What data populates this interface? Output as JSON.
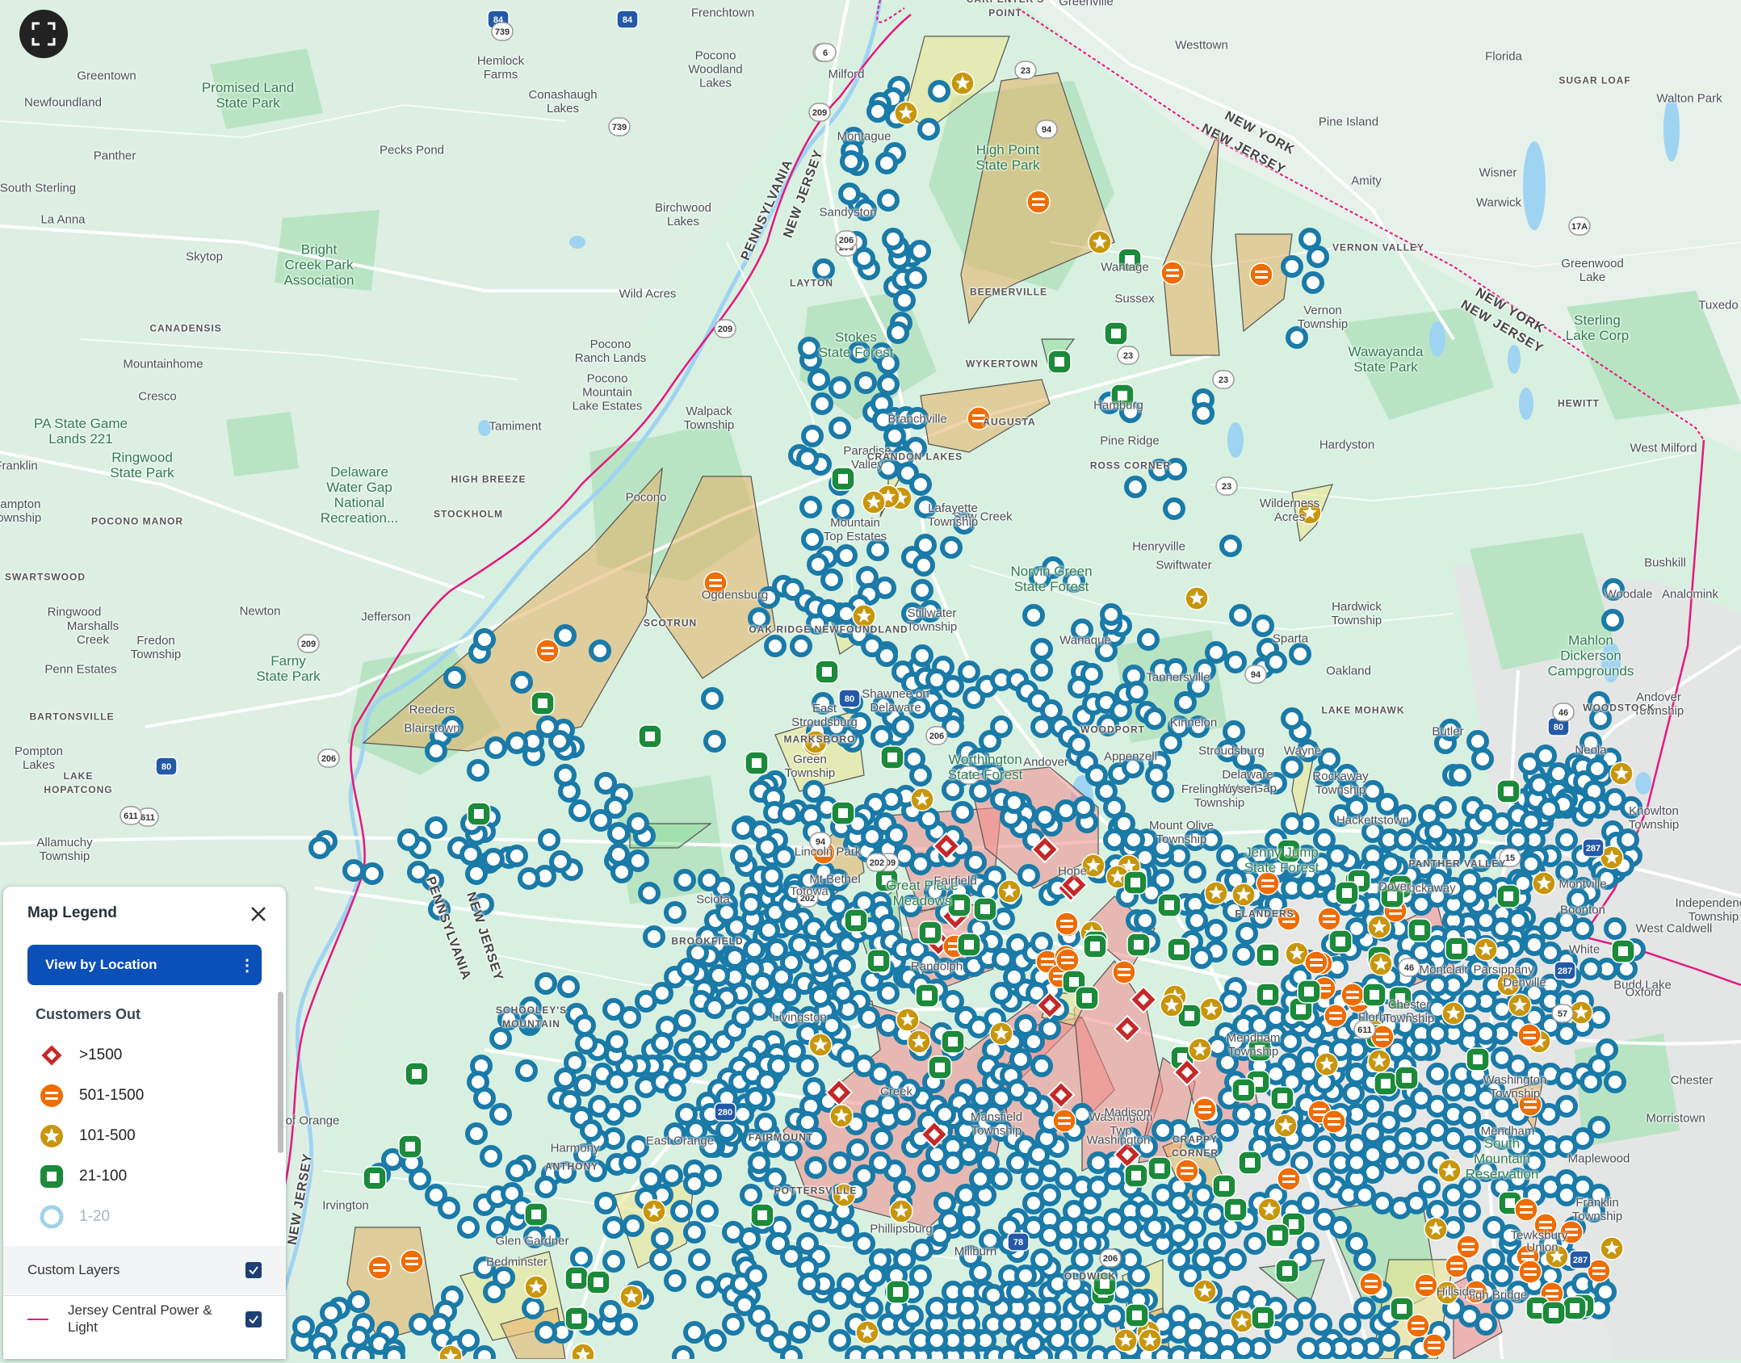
{
  "colors": {
    "land": "#d8f0e0",
    "park": "#b9e4c4",
    "water": "#9fd3f2",
    "state_line": "#e6187f",
    "road": "#ffffff",
    "poly_orange": "#e6b064",
    "poly_yellow": "#efe68e",
    "poly_red": "#f28b8b",
    "poly_green": "#8fdc9a",
    "marker_red": "#c62828",
    "marker_orange": "#ef6c00",
    "marker_gold": "#c8960c",
    "marker_green": "#1b8a3a",
    "marker_blue": "#1a7aa8",
    "marker_faded": "#9fd3e6",
    "button_blue": "#0b4fb8",
    "checkbox": "#1d3f74"
  },
  "map": {
    "labels": [
      {
        "text": "Frenchtown",
        "kind": "town"
      },
      {
        "text": "Greenville",
        "kind": "town"
      },
      {
        "text": "CARPENTER'S\nPOINT",
        "kind": "small"
      },
      {
        "text": "Westtown",
        "kind": "town"
      },
      {
        "text": "Florida",
        "kind": "town"
      },
      {
        "text": "SUGAR LOAF",
        "kind": "small"
      },
      {
        "text": "Walton Park",
        "kind": "town"
      },
      {
        "text": "Greentown",
        "kind": "town"
      },
      {
        "text": "Promised Land\nState Park",
        "kind": "park"
      },
      {
        "text": "Hemlock\nFarms",
        "kind": "town"
      },
      {
        "text": "Pocono\nWoodland\nLakes",
        "kind": "town"
      },
      {
        "text": "Milford",
        "kind": "town"
      },
      {
        "text": "Newfoundland",
        "kind": "town"
      },
      {
        "text": "Conashaugh\nLakes",
        "kind": "town"
      },
      {
        "text": "Montague",
        "kind": "town"
      },
      {
        "text": "High Point\nState Park",
        "kind": "park"
      },
      {
        "text": "Pine Island",
        "kind": "town"
      },
      {
        "text": "Pecks Pond",
        "kind": "town"
      },
      {
        "text": "Panther",
        "kind": "town"
      },
      {
        "text": "Amity",
        "kind": "town"
      },
      {
        "text": "Wisner",
        "kind": "town"
      },
      {
        "text": "South Sterling",
        "kind": "town"
      },
      {
        "text": "Warwick",
        "kind": "town"
      },
      {
        "text": "Sandyston",
        "kind": "town"
      },
      {
        "text": "Birchwood\nLakes",
        "kind": "town"
      },
      {
        "text": "La Anna",
        "kind": "town"
      },
      {
        "text": "Skytop",
        "kind": "town"
      },
      {
        "text": "Bright\nCreek Park\nAssociation",
        "kind": "park"
      },
      {
        "text": "VERNON VALLEY",
        "kind": "small"
      },
      {
        "text": "Greenwood\nLake",
        "kind": "town"
      },
      {
        "text": "LAYTON",
        "kind": "small"
      },
      {
        "text": "Wantage",
        "kind": "town"
      },
      {
        "text": "BEEMERVILLE",
        "kind": "small"
      },
      {
        "text": "Sussex",
        "kind": "town"
      },
      {
        "text": "Vernon\nTownship",
        "kind": "town"
      },
      {
        "text": "Tuxedo",
        "kind": "town"
      },
      {
        "text": "Wild Acres",
        "kind": "town"
      },
      {
        "text": "CANADENSIS",
        "kind": "small"
      },
      {
        "text": "Sterling\nLake Corp",
        "kind": "park"
      },
      {
        "text": "Stokes\nState Forest",
        "kind": "park"
      },
      {
        "text": "Pocono\nRanch Lands",
        "kind": "town"
      },
      {
        "text": "Wawayanda\nState Park",
        "kind": "park"
      },
      {
        "text": "Mountainhome",
        "kind": "town"
      },
      {
        "text": "WYKERTOWN",
        "kind": "small"
      },
      {
        "text": "Pocono\nMountain\nLake Estates",
        "kind": "town"
      },
      {
        "text": "Cresco",
        "kind": "town"
      },
      {
        "text": "HEWITT",
        "kind": "small"
      },
      {
        "text": "Branchville",
        "kind": "town"
      },
      {
        "text": "AUGUSTA",
        "kind": "small"
      },
      {
        "text": "Hamburg",
        "kind": "town"
      },
      {
        "text": "PA State Game\nLands 221",
        "kind": "park"
      },
      {
        "text": "Walpack\nTownship",
        "kind": "town"
      },
      {
        "text": "Tamiment",
        "kind": "town"
      },
      {
        "text": "Pine Ridge",
        "kind": "town"
      },
      {
        "text": "Hardyston",
        "kind": "town"
      },
      {
        "text": "West Milford",
        "kind": "town"
      },
      {
        "text": "Ringwood\nState Park",
        "kind": "park"
      },
      {
        "text": "Paradise\nValley",
        "kind": "town"
      },
      {
        "text": "CRANDON LAKES",
        "kind": "small"
      },
      {
        "text": "ROSS CORNER",
        "kind": "small"
      },
      {
        "text": "Franklin",
        "kind": "town"
      },
      {
        "text": "HIGH BREEZE",
        "kind": "small"
      },
      {
        "text": "Pocono",
        "kind": "town"
      },
      {
        "text": "Saw Creek",
        "kind": "town"
      },
      {
        "text": "Delaware\nWater Gap\nNational\nRecreation...",
        "kind": "park"
      },
      {
        "text": "Lafayette\nTownship",
        "kind": "town"
      },
      {
        "text": "Wilderness\nAcres",
        "kind": "town"
      },
      {
        "text": "Hampton\nTownship",
        "kind": "town"
      },
      {
        "text": "STOCKHOLM",
        "kind": "small"
      },
      {
        "text": "POCONO MANOR",
        "kind": "small"
      },
      {
        "text": "Mountain\nTop Estates",
        "kind": "town"
      },
      {
        "text": "Henryville",
        "kind": "town"
      },
      {
        "text": "Bushkill",
        "kind": "town"
      },
      {
        "text": "SWARTSWOOD",
        "kind": "small"
      },
      {
        "text": "Ogdensburg",
        "kind": "town"
      },
      {
        "text": "Swiftwater",
        "kind": "town"
      },
      {
        "text": "Woodale",
        "kind": "town"
      },
      {
        "text": "Ringwood",
        "kind": "town"
      },
      {
        "text": "SCOTRUN",
        "kind": "small"
      },
      {
        "text": "Stillwater\nTownship",
        "kind": "town"
      },
      {
        "text": "Newton",
        "kind": "town"
      },
      {
        "text": "Norvin Green\nState Forest",
        "kind": "park"
      },
      {
        "text": "Hardwick\nTownship",
        "kind": "town"
      },
      {
        "text": "Analomink",
        "kind": "town"
      },
      {
        "text": "Marshalls\nCreek",
        "kind": "town"
      },
      {
        "text": "Fredon\nTownship",
        "kind": "town"
      },
      {
        "text": "Sparta",
        "kind": "town"
      },
      {
        "text": "OAK RIDGE NEWFOUNDLAND",
        "kind": "small"
      },
      {
        "text": "Wanaque",
        "kind": "town"
      },
      {
        "text": "Tannersville",
        "kind": "town"
      },
      {
        "text": "Penn Estates",
        "kind": "town"
      },
      {
        "text": "Jefferson",
        "kind": "town"
      },
      {
        "text": "Oakland",
        "kind": "town"
      },
      {
        "text": "LAKE MOHAWK",
        "kind": "small"
      },
      {
        "text": "Andover\nTownship",
        "kind": "town"
      },
      {
        "text": "Mahlon\nDickerson\nCampgrounds",
        "kind": "park"
      },
      {
        "text": "Farny\nState Park",
        "kind": "park"
      },
      {
        "text": "Reeders",
        "kind": "town"
      },
      {
        "text": "Shawnee on\nDelaware",
        "kind": "town"
      },
      {
        "text": "Kinnelon",
        "kind": "town"
      },
      {
        "text": "Butler",
        "kind": "town"
      },
      {
        "text": "BARTONSVILLE",
        "kind": "small"
      },
      {
        "text": "East\nStroudsburg",
        "kind": "town"
      },
      {
        "text": "Worthington\nState Forest",
        "kind": "park"
      },
      {
        "text": "WOODSTOCK",
        "kind": "small"
      },
      {
        "text": "Pompton\nLakes",
        "kind": "town"
      },
      {
        "text": "Appenzell",
        "kind": "town"
      },
      {
        "text": "Stroudsburg",
        "kind": "town"
      },
      {
        "text": "Blairstown",
        "kind": "town"
      },
      {
        "text": "MARKSBORO",
        "kind": "small"
      },
      {
        "text": "Andover",
        "kind": "town"
      },
      {
        "text": "WOODPORT",
        "kind": "small"
      },
      {
        "text": "Delaware\nWater Gap",
        "kind": "town"
      },
      {
        "text": "Green\nTownship",
        "kind": "town"
      },
      {
        "text": "Frelinghuysen\nTownship",
        "kind": "town"
      },
      {
        "text": "Rockaway\nTownship",
        "kind": "town"
      },
      {
        "text": "Neola",
        "kind": "town"
      },
      {
        "text": "LAKE\nHOPATCONG",
        "kind": "small"
      },
      {
        "text": "Wayne",
        "kind": "town"
      },
      {
        "text": "Knowlton\nTownship",
        "kind": "town"
      },
      {
        "text": "Mount Olive\nTownship",
        "kind": "town"
      },
      {
        "text": "Hackettstown",
        "kind": "town"
      },
      {
        "text": "Allamuchy\nTownship",
        "kind": "town"
      },
      {
        "text": "Lincoln Park",
        "kind": "town"
      },
      {
        "text": "Sciota",
        "kind": "town"
      },
      {
        "text": "Hope",
        "kind": "town"
      },
      {
        "text": "Jenny Jump\nState Forest",
        "kind": "park"
      },
      {
        "text": "PANTHER VALLEY",
        "kind": "small"
      },
      {
        "text": "Rockaway",
        "kind": "town"
      },
      {
        "text": "Montville",
        "kind": "town"
      },
      {
        "text": "Great Piece\nMeadows",
        "kind": "park"
      },
      {
        "text": "Totowa",
        "kind": "town"
      },
      {
        "text": "Mt Bethel",
        "kind": "town"
      },
      {
        "text": "Dover",
        "kind": "town"
      },
      {
        "text": "Boonton",
        "kind": "town"
      },
      {
        "text": "Independence\nTownship",
        "kind": "town"
      },
      {
        "text": "Fairfield",
        "kind": "town"
      },
      {
        "text": "West Caldwell",
        "kind": "town"
      },
      {
        "text": "FLANDERS",
        "kind": "small"
      },
      {
        "text": "White",
        "kind": "town"
      },
      {
        "text": "Parsippany",
        "kind": "town"
      },
      {
        "text": "BROOKFIELD",
        "kind": "small"
      },
      {
        "text": "Budd Lake",
        "kind": "town"
      },
      {
        "text": "Randolph",
        "kind": "town"
      },
      {
        "text": "Denville",
        "kind": "town"
      },
      {
        "text": "Montclair",
        "kind": "town"
      },
      {
        "text": "Oxford",
        "kind": "town"
      },
      {
        "text": "SCHOOLEY'S\nMOUNTAIN",
        "kind": "small"
      },
      {
        "text": "Mendham\nTownship",
        "kind": "town"
      },
      {
        "text": "Florham Park",
        "kind": "town"
      },
      {
        "text": "Livingston",
        "kind": "town"
      },
      {
        "text": "Washington\nTownship",
        "kind": "town"
      },
      {
        "text": "Chester",
        "kind": "town"
      },
      {
        "text": "Chester\nTownship",
        "kind": "town"
      },
      {
        "text": "Mendham",
        "kind": "town"
      },
      {
        "text": "Morristown",
        "kind": "town"
      },
      {
        "text": "Creek",
        "kind": "town"
      },
      {
        "text": "Mansfield\nTownship",
        "kind": "town"
      },
      {
        "text": "Washington\nTwp",
        "kind": "town"
      },
      {
        "text": "Washington",
        "kind": "town"
      },
      {
        "text": "Madison",
        "kind": "town"
      },
      {
        "text": "City of Orange",
        "kind": "town"
      },
      {
        "text": "East Orange",
        "kind": "town"
      },
      {
        "text": "CRAPPY\nCORNER",
        "kind": "small"
      },
      {
        "text": "Harmony",
        "kind": "town"
      },
      {
        "text": "ANTHONY",
        "kind": "small"
      },
      {
        "text": "South\nMountain\nReservation",
        "kind": "park"
      },
      {
        "text": "Maplewood",
        "kind": "town"
      },
      {
        "text": "FAIRMOUNT",
        "kind": "small"
      },
      {
        "text": "Irvington",
        "kind": "town"
      },
      {
        "text": "POTTERSVILLE",
        "kind": "small"
      },
      {
        "text": "Franklin\nTownship",
        "kind": "town"
      },
      {
        "text": "Phillipsburg",
        "kind": "town"
      },
      {
        "text": "Tewksbury",
        "kind": "town"
      },
      {
        "text": "Millburn",
        "kind": "town"
      },
      {
        "text": "Union",
        "kind": "town"
      },
      {
        "text": "Glen Gardner",
        "kind": "town"
      },
      {
        "text": "OLDWICK",
        "kind": "small"
      },
      {
        "text": "Bedminster",
        "kind": "town"
      },
      {
        "text": "High Bridge",
        "kind": "town"
      },
      {
        "text": "Hillside",
        "kind": "town"
      },
      {
        "text": "PENNSYLVANIA",
        "kind": "state"
      },
      {
        "text": "NEW JERSEY",
        "kind": "state"
      },
      {
        "text": "NEW YORK",
        "kind": "state"
      },
      {
        "text": "NEW JERSEY",
        "kind": "state"
      },
      {
        "text": "NEW YORK",
        "kind": "state"
      },
      {
        "text": "NEW JERSEY",
        "kind": "state"
      },
      {
        "text": "PENNSYLVANIA",
        "kind": "state"
      },
      {
        "text": "NEW JERSEY",
        "kind": "state"
      },
      {
        "text": "NEW JERSEY",
        "kind": "state"
      }
    ],
    "road_shields": [
      "84",
      "739",
      "84",
      "6",
      "209",
      "739",
      "206",
      "23",
      "209",
      "6",
      "23",
      "94",
      "17A",
      "23",
      "94",
      "206",
      "23",
      "206",
      "23",
      "209",
      "94",
      "206",
      "80",
      "611",
      "209",
      "611",
      "80",
      "46",
      "287",
      "202",
      "280",
      "611",
      "57",
      "287",
      "78",
      "206",
      "202",
      "80",
      "94",
      "15",
      "46",
      "287"
    ]
  },
  "fullscreen": {
    "icon": "fullscreen-icon"
  },
  "legend": {
    "title": "Map Legend",
    "close_icon": "close-icon",
    "view_button": "View by Location",
    "view_menu_icon": "more-vertical-icon",
    "section_title": "Customers Out",
    "items": [
      {
        "label": ">1500",
        "icon": "diamond-icon",
        "color": "#c62828"
      },
      {
        "label": "501-1500",
        "icon": "equals-icon",
        "color": "#ef6c00"
      },
      {
        "label": "101-500",
        "icon": "star-icon",
        "color": "#c8960c"
      },
      {
        "label": "21-100",
        "icon": "square-icon",
        "color": "#1b8a3a"
      },
      {
        "label": "1-20",
        "icon": "circle-icon",
        "color": "#9fd3e6"
      }
    ],
    "custom_layers_label": "Custom Layers",
    "custom_layers_checked": true,
    "layers": [
      {
        "label": "Jersey Central Power & Light",
        "checked": true,
        "color": "#e6187f"
      }
    ]
  }
}
